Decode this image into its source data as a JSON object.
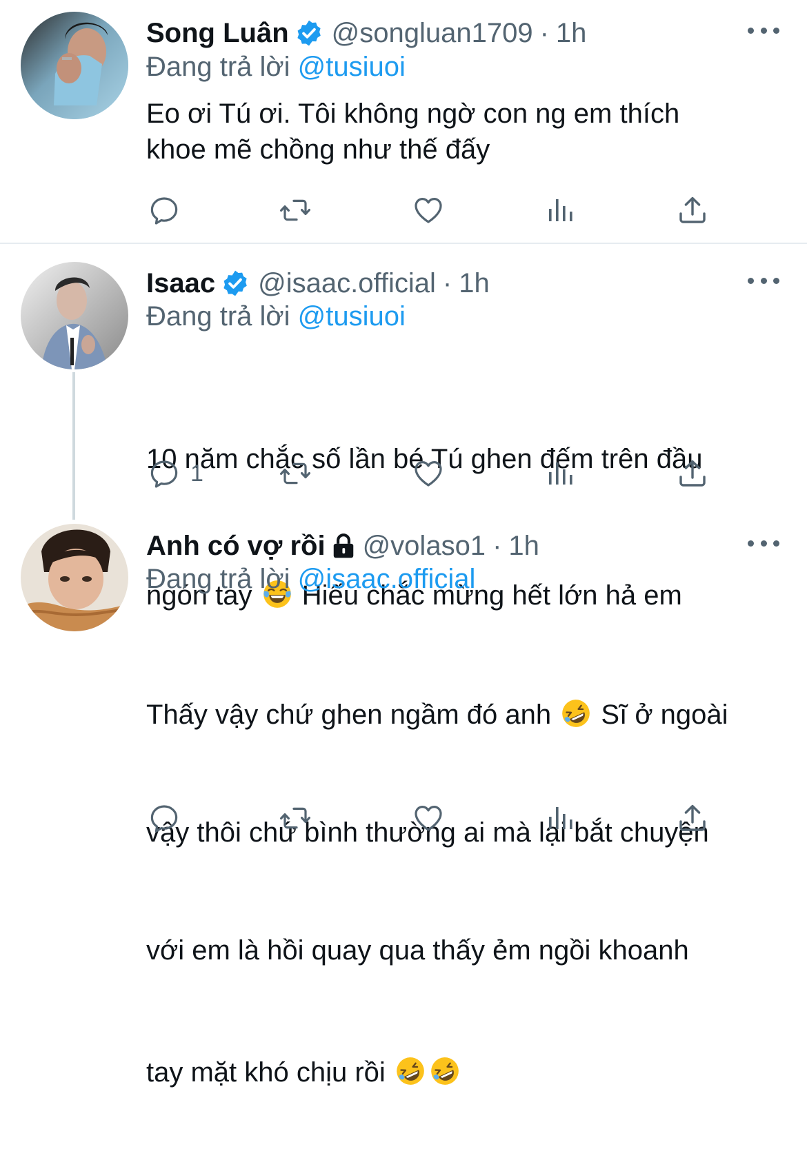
{
  "tweets": [
    {
      "name": "Song Luân",
      "handle": "@songluan1709",
      "dot": "·",
      "time": "1h",
      "reply_prefix": "Đang trả lời",
      "reply_to": "@tusiuoi",
      "text": "Eo ơi Tú ơi. Tôi không ngờ con ng em thích\nkhoe mẽ chồng như thế đấy",
      "verified": true,
      "reply_count": ""
    },
    {
      "name": "Isaac",
      "handle": "@isaac.official",
      "dot": "·",
      "time": "1h",
      "reply_prefix": "Đang trả lời",
      "reply_to": "@tusiuoi",
      "text_line1": "10 năm chắc số lần bé Tú ghen đếm trên đầu",
      "text_line2a": "ngón tay",
      "text_line2b": "Hiếu chắc mừng hết lớn hả em",
      "emoji": "face-with-tears-of-joy",
      "verified": true,
      "reply_count": "1"
    },
    {
      "name": "Anh có vợ rồi",
      "handle": "@volaso1",
      "dot": "·",
      "time": "1h",
      "reply_prefix": "Đang trả lời",
      "reply_to": "@isaac.official",
      "text_line1a": "Thấy vậy chứ ghen ngầm đó anh",
      "text_line1b": "Sĩ ở ngoài",
      "text_line2": "vậy thôi chứ bình thường ai mà lại bắt chuyện",
      "text_line3": "với em là hồi quay qua thấy ẻm ngồi khoanh",
      "text_line4": "tay mặt khó chịu rồi",
      "emoji": "rolling-on-the-floor-laughing",
      "locked": true,
      "reply_count": ""
    }
  ],
  "colors": {
    "accent": "#1d9bf0",
    "secondary": "#536471",
    "text": "#0f1419",
    "divider": "#e6ecf0",
    "thread_line": "#cfd9de"
  },
  "icons": [
    "reply-icon",
    "retweet-icon",
    "like-icon",
    "analytics-icon",
    "share-icon",
    "more-icon",
    "verified-badge-icon",
    "lock-icon"
  ]
}
